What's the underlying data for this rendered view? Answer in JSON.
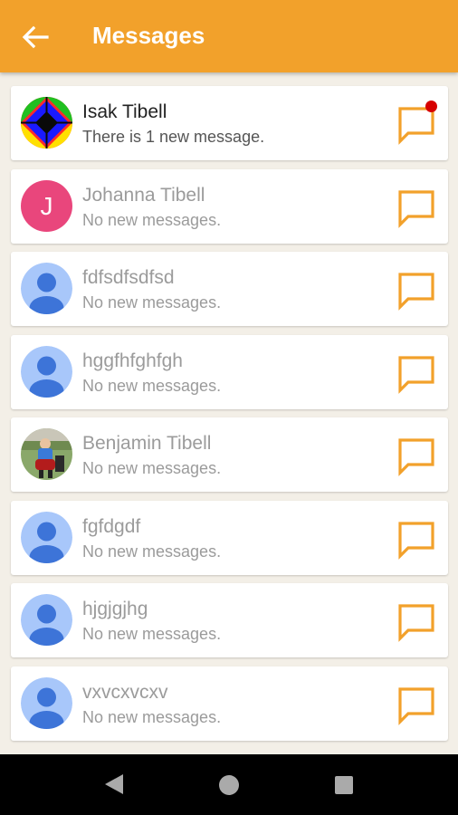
{
  "app": {
    "title": "Messages"
  },
  "colors": {
    "appbar": "#f2a12b",
    "chat_icon": "#f2a12b",
    "badge": "#d60000"
  },
  "contacts": [
    {
      "name": "Isak Tibell",
      "status": "There is 1 new message.",
      "avatar": "colorful-pattern",
      "unread": true
    },
    {
      "name": "Johanna Tibell",
      "status": "No new messages.",
      "avatar": "letter",
      "avatar_letter": "J",
      "unread": false
    },
    {
      "name": "fdfsdfsdfsd",
      "status": "No new messages.",
      "avatar": "default-person",
      "unread": false
    },
    {
      "name": "hggfhfghfgh",
      "status": "No new messages.",
      "avatar": "default-person",
      "unread": false
    },
    {
      "name": "Benjamin Tibell",
      "status": "No new messages.",
      "avatar": "photo",
      "unread": false
    },
    {
      "name": "fgfdgdf",
      "status": "No new messages.",
      "avatar": "default-person",
      "unread": false
    },
    {
      "name": "hjgjgjhg",
      "status": "No new messages.",
      "avatar": "default-person",
      "unread": false
    },
    {
      "name": "vxvcxvcxv",
      "status": "No new messages.",
      "avatar": "default-person",
      "unread": false
    }
  ]
}
